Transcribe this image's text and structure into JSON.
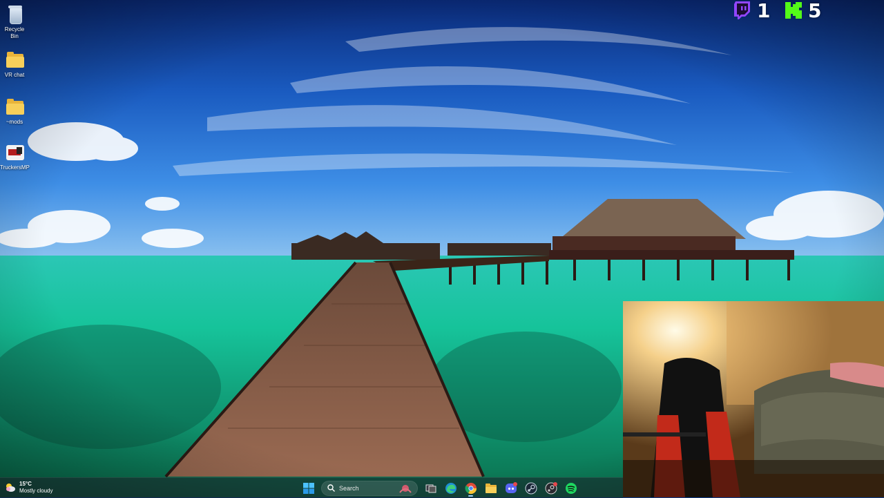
{
  "desktop": {
    "icons": [
      {
        "label": "Recycle Bin",
        "icon": "recycle-bin-icon"
      },
      {
        "label": "VR chat",
        "icon": "folder-icon"
      },
      {
        "label": "~mods",
        "icon": "folder-icon"
      },
      {
        "label": "TruckersMP",
        "icon": "truckersmp-icon"
      }
    ]
  },
  "overlay": {
    "twitch_count": "1",
    "kick_count": "5",
    "twitch_color": "#9146ff",
    "kick_color": "#53fc18"
  },
  "taskbar": {
    "weather_temp": "15°C",
    "weather_desc": "Mostly cloudy",
    "search_label": "Search",
    "apps": [
      "windows-start-icon",
      "search-box",
      "task-view-icon",
      "edge-icon",
      "chrome-icon",
      "file-explorer-icon",
      "discord-icon",
      "steam-icon",
      "steam-alt-icon",
      "spotify-icon"
    ]
  }
}
